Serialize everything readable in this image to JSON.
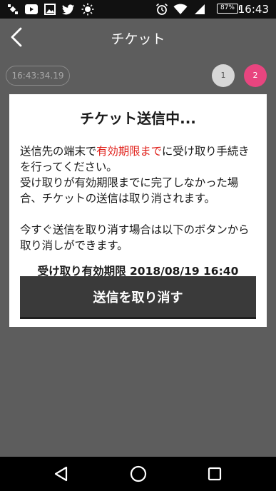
{
  "status_bar": {
    "time": "16:43",
    "battery": "87%",
    "icons": [
      "signal-satellite-icon",
      "youtube-icon",
      "image-icon",
      "twitter-icon",
      "brightness-icon",
      "alarm-icon",
      "wifi-icon",
      "cell-signal-icon",
      "battery-icon"
    ]
  },
  "appbar": {
    "title": "チケット",
    "back_icon": "chevron-left-icon"
  },
  "time_pill": "16:43:34.19",
  "steps": [
    "1",
    "2"
  ],
  "dialog": {
    "title": "チケット送信中...",
    "para1_before": "送信先の端末で",
    "para1_highlight": "有効期限まで",
    "para1_after": "に受け取り手続きを行ってください。",
    "para2": "受け取りが有効期限までに完了しなかった場合、チケットの送信は取り消されます。",
    "para3": "今すぐ送信を取り消す場合は以下のボタンから取り消しができます。",
    "expiry": "受け取り有効期限 2018/08/19 16:40",
    "cancel_button": "送信を取り消す"
  },
  "colors": {
    "background": "#5d5d5d",
    "highlight": "#e0201a",
    "active_step": "#e8457f",
    "button": "#3a3a3a"
  }
}
